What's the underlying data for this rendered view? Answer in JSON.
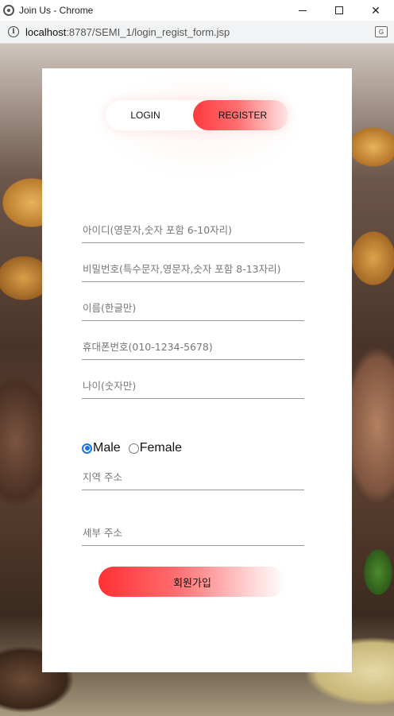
{
  "window": {
    "title": "Join Us - Chrome",
    "minimize_glyph": "",
    "maximize_glyph": "",
    "close_glyph": "✕"
  },
  "address": {
    "host": "localhost",
    "path": ":8787/SEMI_1/login_regist_form.jsp",
    "info_glyph": "i",
    "translate_glyph": "G"
  },
  "toggle": {
    "login_label": "LOGIN",
    "register_label": "REGISTER",
    "active": "register"
  },
  "form": {
    "fields": {
      "id_placeholder": "아이디(영문자,숫자 포함 6-10자리)",
      "pw_placeholder": "비밀번호(특수문자,영문자,숫자 포함 8-13자리)",
      "name_placeholder": "이름(한글만)",
      "phone_placeholder": "휴대폰번호(010-1234-5678)",
      "age_placeholder": "나이(숫자만)",
      "region_placeholder": "지역 주소",
      "detail_placeholder": "세부 주소"
    },
    "gender": {
      "male_label": "Male",
      "female_label": "Female",
      "selected": "male"
    },
    "submit_label": "회원가입"
  },
  "colors": {
    "accent": "#ff3b3f",
    "radio": "#1a73e8"
  }
}
